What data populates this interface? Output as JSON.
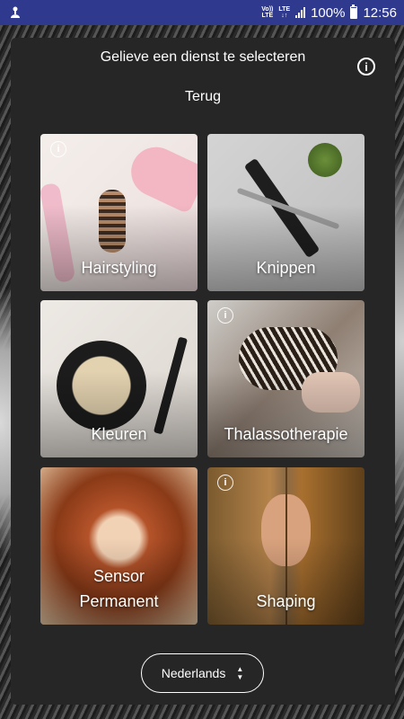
{
  "status": {
    "carrier_top": "Vo))",
    "carrier_bottom": "LTE",
    "lte": "LTE",
    "battery": "100%",
    "time": "12:56"
  },
  "header": {
    "title": "Gelieve een dienst te selecteren",
    "info_icon": "i",
    "back": "Terug"
  },
  "services": [
    {
      "label": "Hairstyling",
      "info": true
    },
    {
      "label": "Knippen",
      "info": false
    },
    {
      "label": "Kleuren",
      "info": false
    },
    {
      "label": "Thalassotherapie",
      "info": true
    },
    {
      "label_line1": "Sensor",
      "label_line2": "Permanent",
      "info": false
    },
    {
      "label": "Shaping",
      "info": true
    }
  ],
  "language": {
    "selected": "Nederlands",
    "up": "▲",
    "down": "▼"
  },
  "colors": {
    "status_bar": "#2f3a8f",
    "panel": "#262626"
  }
}
